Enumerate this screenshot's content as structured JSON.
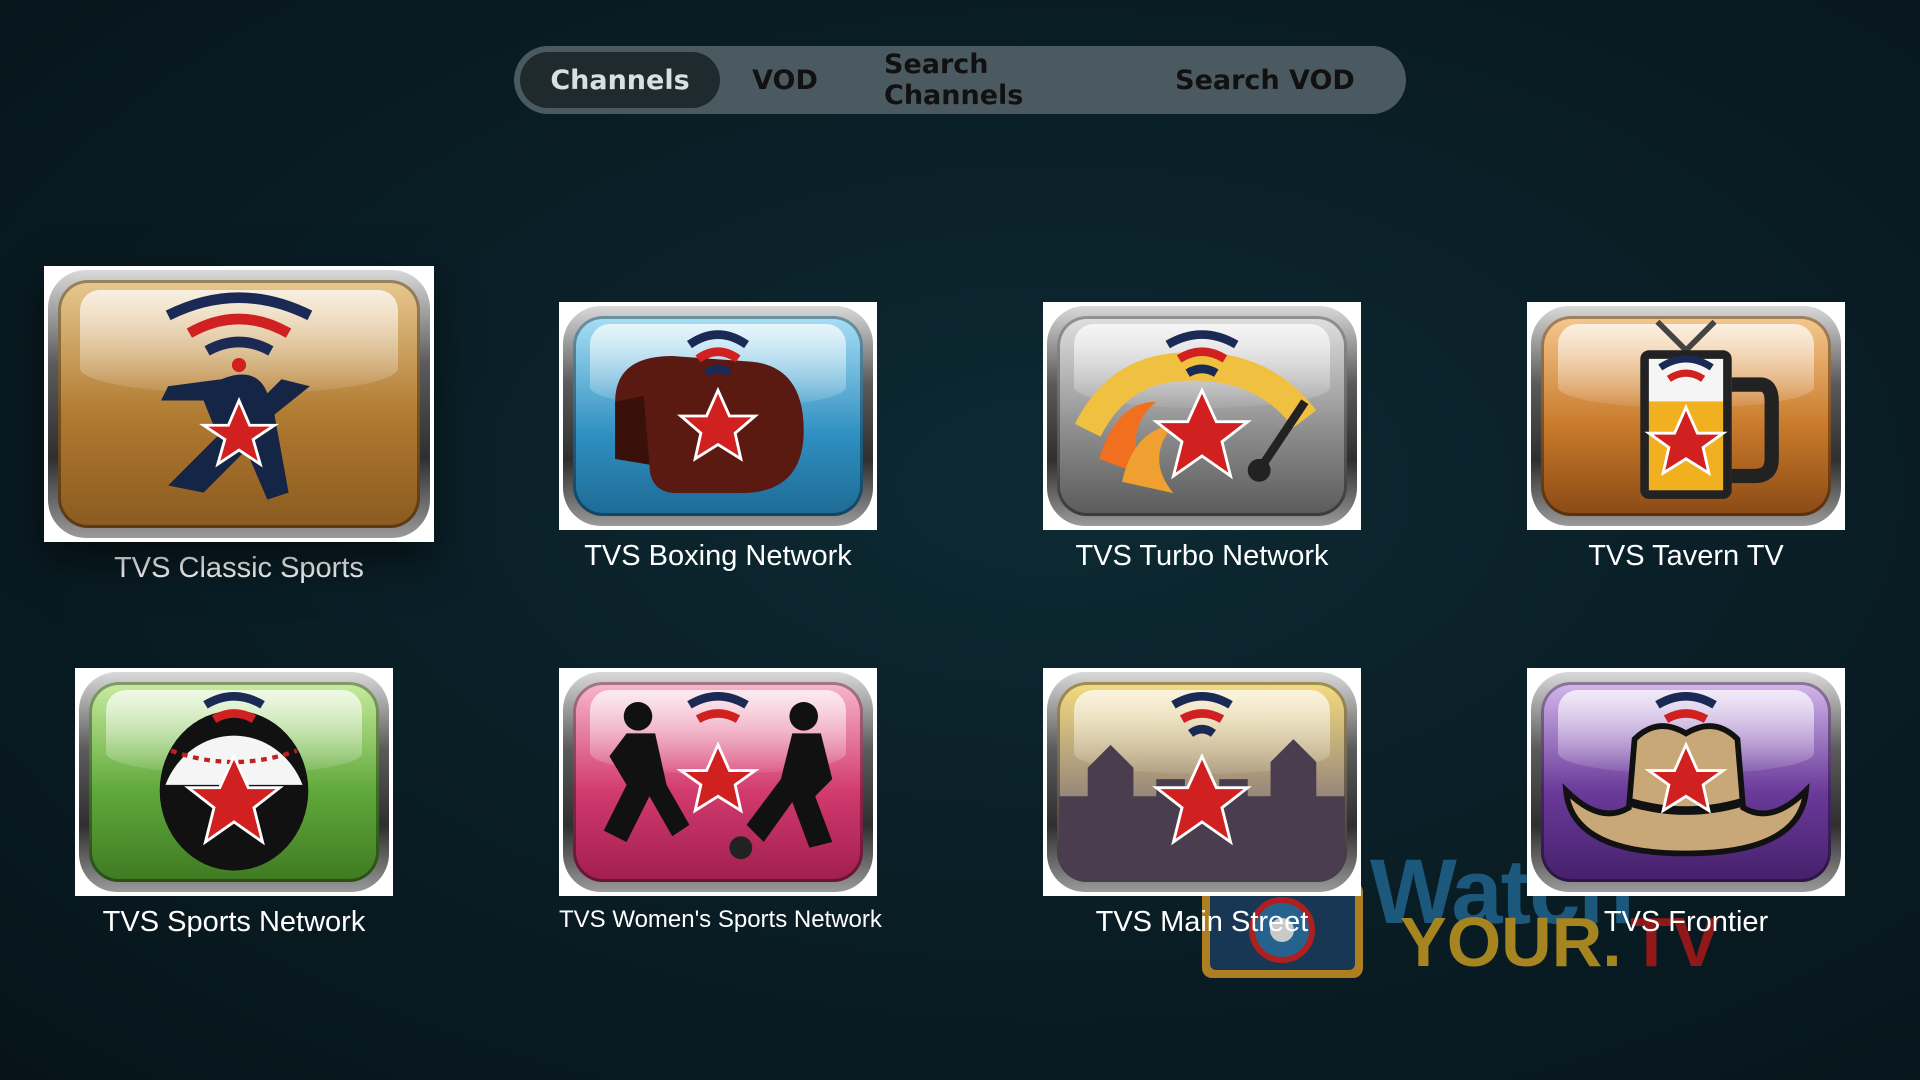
{
  "tabs": [
    {
      "label": "Channels",
      "active": true
    },
    {
      "label": "VOD",
      "active": false
    },
    {
      "label": "Search Channels",
      "active": false
    },
    {
      "label": "Search VOD",
      "active": false
    }
  ],
  "channels": [
    {
      "name": "TVS Classic Sports",
      "icon": "baseball-pitcher-icon",
      "color": "#b08040",
      "focused": true
    },
    {
      "name": "TVS Boxing Network",
      "icon": "boxing-glove-icon",
      "color": "#2f8fc0",
      "focused": false
    },
    {
      "name": "TVS Turbo Network",
      "icon": "speedometer-flame-icon",
      "color": "#8a8a8a",
      "focused": false
    },
    {
      "name": "TVS Tavern TV",
      "icon": "beer-mug-icon",
      "color": "#c97a2a",
      "focused": false
    },
    {
      "name": "TVS Sports Network",
      "icon": "baseball-soccer-ball-icon",
      "color": "#5fa83a",
      "focused": false
    },
    {
      "name": "TVS Women's Sports Network",
      "icon": "female-soccer-players-icon",
      "color": "#d23a6e",
      "focused": false
    },
    {
      "name": "TVS Main Street",
      "icon": "town-skyline-icon",
      "color": "#c9a840",
      "focused": false
    },
    {
      "name": "TVS Frontier",
      "icon": "cowboy-hat-icon",
      "color": "#6a3a9a",
      "focused": false
    }
  ],
  "watermark": {
    "line1": "Watch",
    "line2": "YOUR.",
    "line3": "TV"
  }
}
